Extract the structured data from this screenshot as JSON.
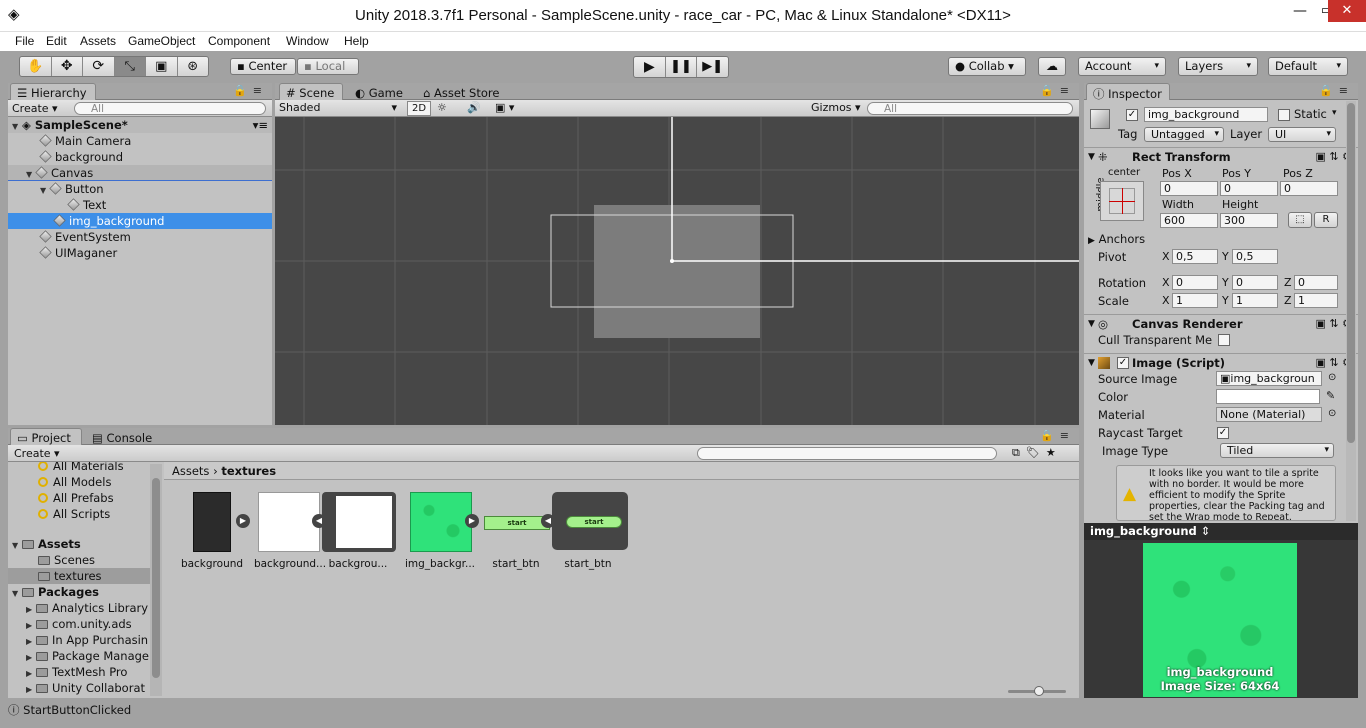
{
  "window": {
    "title": "Unity 2018.3.7f1 Personal - SampleScene.unity - race_car - PC, Mac & Linux Standalone* <DX11>"
  },
  "menu": [
    "File",
    "Edit",
    "Assets",
    "GameObject",
    "Component",
    "Window",
    "Help"
  ],
  "toolbar": {
    "center": "Center",
    "local": "Local",
    "collab": "Collab",
    "account": "Account",
    "layers": "Layers",
    "layout": "Default"
  },
  "hierarchy": {
    "tab": "Hierarchy",
    "create": "Create",
    "search_placeholder": "All",
    "scene": "SampleScene*",
    "items": [
      "Main Camera",
      "background",
      "Canvas",
      "Button",
      "Text",
      "img_background",
      "EventSystem",
      "UIMaganer"
    ]
  },
  "scene": {
    "tabs": [
      "Scene",
      "Game",
      "Asset Store"
    ],
    "shading": "Shaded",
    "mode2d": "2D",
    "gizmos": "Gizmos",
    "search_placeholder": "All"
  },
  "project": {
    "tabs": [
      "Project",
      "Console"
    ],
    "create": "Create",
    "favorites": [
      "All Materials",
      "All Models",
      "All Prefabs",
      "All Scripts"
    ],
    "assets_root": "Assets",
    "assets": [
      "Scenes",
      "textures"
    ],
    "packages_root": "Packages",
    "packages": [
      "Analytics Library",
      "com.unity.ads",
      "In App Purchasin",
      "Package Manage",
      "TextMesh Pro",
      "Unity Collaborat"
    ],
    "breadcrumb": [
      "Assets",
      "textures"
    ],
    "files": [
      "background",
      "background...",
      "backgrou...",
      "img_backgr...",
      "start_btn",
      "start_btn"
    ],
    "btn_text": "start"
  },
  "inspector": {
    "tab": "Inspector",
    "name": "img_background",
    "static": "Static",
    "tag_label": "Tag",
    "tag": "Untagged",
    "layer_label": "Layer",
    "layer": "UI",
    "rect": {
      "title": "Rect Transform",
      "anchor_h": "center",
      "anchor_v": "middle",
      "posx_label": "Pos X",
      "posy_label": "Pos Y",
      "posz_label": "Pos Z",
      "posx": "0",
      "posy": "0",
      "posz": "0",
      "width_label": "Width",
      "height_label": "Height",
      "width": "600",
      "height": "300",
      "r": "R",
      "anchors": "Anchors",
      "pivot": "Pivot",
      "pivot_x": "0,5",
      "pivot_y": "0,5",
      "rotation": "Rotation",
      "scale": "Scale",
      "rot": [
        "0",
        "0",
        "0"
      ],
      "scl": [
        "1",
        "1",
        "1"
      ],
      "x": "X",
      "y": "Y",
      "z": "Z"
    },
    "canvas_renderer": {
      "title": "Canvas Renderer",
      "cull": "Cull Transparent Me"
    },
    "image": {
      "title": "Image (Script)",
      "source_label": "Source Image",
      "source": "img_backgroun",
      "color_label": "Color",
      "material_label": "Material",
      "material": "None (Material)",
      "raycast_label": "Raycast Target",
      "type_label": "Image Type",
      "type": "Tiled",
      "warning": "It looks like you want to tile a sprite with no border. It would be more efficient to modify the Sprite properties, clear the Packing tag and set the Wrap mode to Repeat."
    },
    "preview": {
      "title": "img_background",
      "name": "img_background",
      "size": "Image Size: 64x64"
    }
  },
  "status": {
    "message": "StartButtonClicked"
  },
  "colors": {
    "accent": "#3d8fe8",
    "green": "#2fe27a",
    "scene_bg": "#474747"
  }
}
